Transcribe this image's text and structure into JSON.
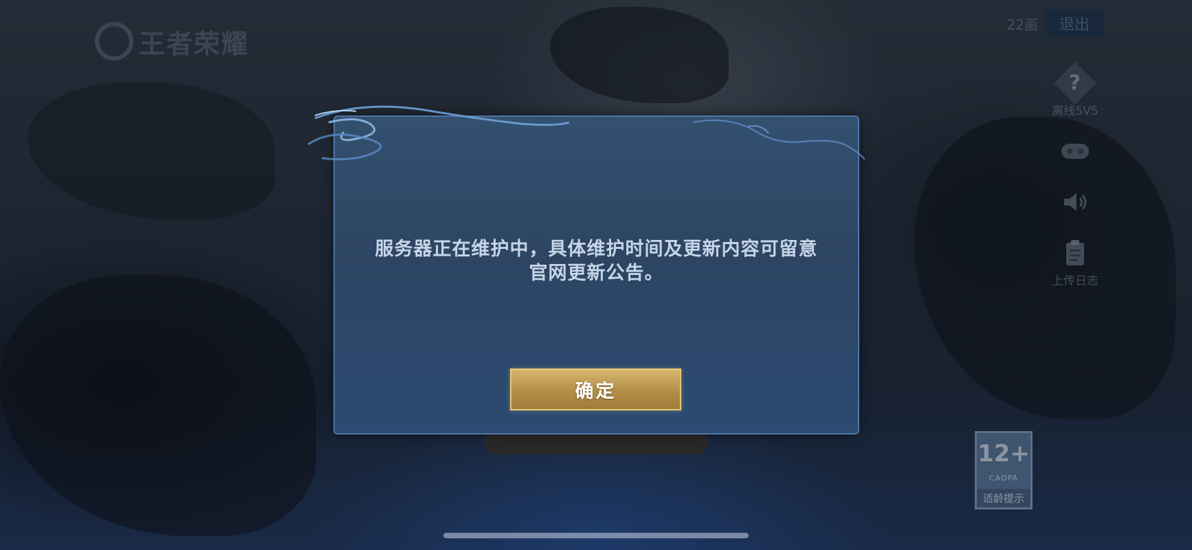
{
  "top_bar": {
    "logo_text": "王者荣耀",
    "ping": "22画",
    "exit_label": "退出"
  },
  "side_menu": {
    "items": [
      {
        "icon": "help-icon",
        "label": "离线5V5"
      },
      {
        "icon": "gamepad-icon",
        "label": ""
      },
      {
        "icon": "speaker-icon",
        "label": ""
      },
      {
        "icon": "clipboard-icon",
        "label": "上传日志"
      }
    ]
  },
  "dialog": {
    "message_line1": "服务器正在维护中，具体维护时间及更新内容可留意",
    "message_line2": "官网更新公告。",
    "confirm_label": "确定"
  },
  "rating": {
    "age": "12+",
    "org": "CADPA",
    "text": "适龄提示"
  },
  "colors": {
    "dialog_bg": "#2d4563",
    "dialog_border": "#4f76a8",
    "button_gold": "#c4a15a",
    "message_text": "#c6d5e8"
  }
}
